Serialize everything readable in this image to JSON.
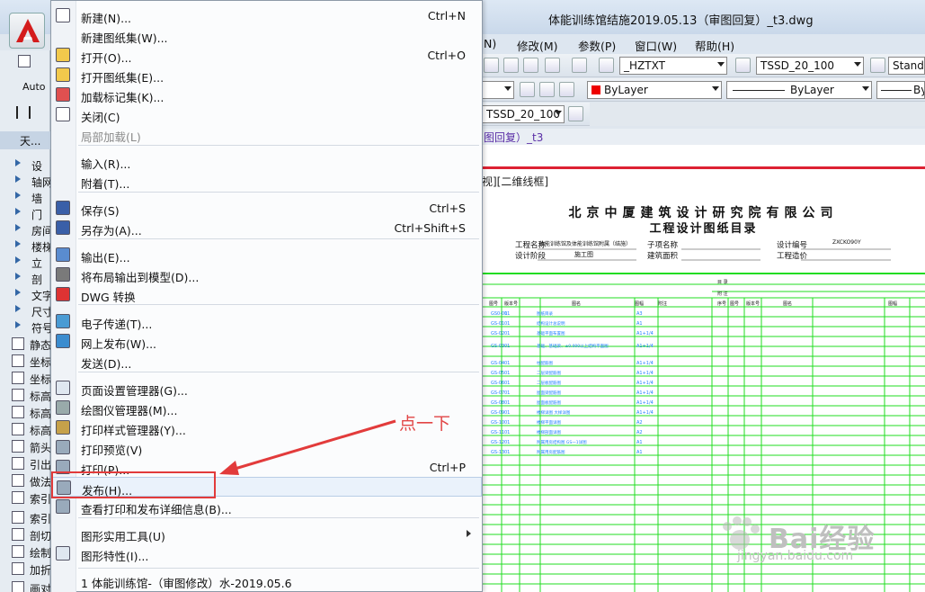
{
  "window": {
    "title": "体能训练馆结施2019.05.13（审图回复）_t3.dwg"
  },
  "menubar": {
    "items": [
      "N)",
      "修改(M)",
      "参数(P)",
      "窗口(W)",
      "帮助(H)"
    ]
  },
  "toolbar1": {
    "textstyle": "_HZTXT",
    "dimstyle": "TSSD_20_100",
    "tablestyle": "Standa"
  },
  "toolbar2": {
    "color": "ByLayer",
    "linetype": "ByLayer",
    "lineweight": "By"
  },
  "toolbar3": {
    "style": "TSSD_20_100"
  },
  "document": {
    "tab_fragment": "图回复）_t3",
    "view_label": "视][二维线框]"
  },
  "drawing": {
    "company": "北京中厦建筑设计研究院有限公司",
    "title": "工程设计图纸目录",
    "h_project": "工程名称",
    "h_project_val": "体能训练馆及体能训练馆附属（结施）",
    "h_subitem": "子项名称",
    "h_design_no": "设计编号",
    "h_design_no_val": "ZXCKO90Y",
    "h_stage": "设计阶段",
    "h_stage_val": "施工图",
    "h_area": "建筑面积",
    "h_cost": "工程造价",
    "col_headers": [
      "图号",
      "版本号",
      "图名",
      "图幅",
      "附注",
      "序号",
      "图号",
      "版本号",
      "图名",
      "图幅"
    ],
    "rows": [
      {
        "no": "GS0-01",
        "ver": "01",
        "name": "图纸目录",
        "size": "A3"
      },
      {
        "no": "GS-01",
        "ver": "01",
        "name": "结构设计总说明",
        "size": "A1"
      },
      {
        "no": "GS-02",
        "ver": "01",
        "name": "基础平面布置图",
        "size": "A1+1/4"
      },
      {
        "no": "GS-03",
        "ver": "01",
        "name": "基础、基础梁、±0.000以上结构平面图",
        "size": "A1+1/4"
      },
      {
        "no": "GS-04",
        "ver": "01",
        "name": "柱配筋图",
        "size": "A1+1/4"
      },
      {
        "no": "GS-05",
        "ver": "01",
        "name": "二层梁配筋图",
        "size": "A1+1/4"
      },
      {
        "no": "GS-06",
        "ver": "01",
        "name": "二层板配筋图",
        "size": "A1+1/4"
      },
      {
        "no": "GS-07",
        "ver": "01",
        "name": "屋面梁配筋图",
        "size": "A1+1/4"
      },
      {
        "no": "GS-08",
        "ver": "01",
        "name": "屋面板配筋图",
        "size": "A1+1/4"
      },
      {
        "no": "GS-09",
        "ver": "01",
        "name": "楼梯详图 大样详图",
        "size": "A1+1/4"
      },
      {
        "no": "GS-10",
        "ver": "01",
        "name": "楼梯平面详图",
        "size": "A2"
      },
      {
        "no": "GS-11",
        "ver": "01",
        "name": "楼梯剖面详图",
        "size": "A2"
      },
      {
        "no": "GS-12",
        "ver": "01",
        "name": "附属用房结构图 GS一1详图",
        "size": "A1"
      },
      {
        "no": "GS-13",
        "ver": "01",
        "name": "附属用房配筋图",
        "size": "A1"
      }
    ]
  },
  "leftpanel": {
    "ribbon1": "Auto",
    "tab": "天...",
    "items": [
      "设",
      "轴网",
      "墙",
      "门",
      "房间",
      "楼梯",
      "立",
      "剖",
      "文字",
      "尺寸",
      "符号"
    ],
    "tools": [
      "静态",
      "坐标",
      "坐标",
      "标高",
      "标高",
      "标高",
      "箭头",
      "引出",
      "做法",
      "索引",
      "索引",
      "剖切",
      "绘制",
      "加折",
      "画对"
    ]
  },
  "menu": {
    "items": [
      {
        "icon": "new-icon",
        "label": "新建(N)...",
        "shortcut": "Ctrl+N"
      },
      {
        "icon": "",
        "label": "新建图纸集(W)...",
        "shortcut": ""
      },
      {
        "icon": "open-icon",
        "label": "打开(O)...",
        "shortcut": "Ctrl+O"
      },
      {
        "icon": "open-sheetset-icon",
        "label": "打开图纸集(E)...",
        "shortcut": ""
      },
      {
        "icon": "markup-icon",
        "label": "加载标记集(K)...",
        "shortcut": ""
      },
      {
        "icon": "close-icon",
        "label": "关闭(C)",
        "shortcut": ""
      },
      {
        "icon": "",
        "label": "局部加载(L)",
        "shortcut": ""
      },
      {
        "icon": "",
        "label": "输入(R)...",
        "shortcut": ""
      },
      {
        "icon": "",
        "label": "附着(T)...",
        "shortcut": ""
      },
      {
        "icon": "save-icon",
        "label": "保存(S)",
        "shortcut": "Ctrl+S"
      },
      {
        "icon": "saveas-icon",
        "label": "另存为(A)...",
        "shortcut": "Ctrl+Shift+S"
      },
      {
        "icon": "export-icon",
        "label": "输出(E)...",
        "shortcut": ""
      },
      {
        "icon": "layout-to-model-icon",
        "label": "将布局输出到模型(D)...",
        "shortcut": ""
      },
      {
        "icon": "dwg-convert-icon",
        "label": "DWG 转换",
        "shortcut": ""
      },
      {
        "icon": "etransmit-icon",
        "label": "电子传递(T)...",
        "shortcut": ""
      },
      {
        "icon": "publish-web-icon",
        "label": "网上发布(W)...",
        "shortcut": ""
      },
      {
        "icon": "",
        "label": "发送(D)...",
        "shortcut": ""
      },
      {
        "icon": "page-setup-icon",
        "label": "页面设置管理器(G)...",
        "shortcut": ""
      },
      {
        "icon": "plotter-icon",
        "label": "绘图仪管理器(M)...",
        "shortcut": ""
      },
      {
        "icon": "plot-style-icon",
        "label": "打印样式管理器(Y)...",
        "shortcut": ""
      },
      {
        "icon": "plot-preview-icon",
        "label": "打印预览(V)",
        "shortcut": ""
      },
      {
        "icon": "plot-icon",
        "label": "打印(P)...",
        "shortcut": "Ctrl+P"
      },
      {
        "icon": "publish-icon",
        "label": "发布(H)...",
        "shortcut": ""
      },
      {
        "icon": "plot-details-icon",
        "label": "查看打印和发布详细信息(B)...",
        "shortcut": ""
      },
      {
        "icon": "",
        "label": "图形实用工具(U)",
        "shortcut": ""
      },
      {
        "icon": "drawing-props-icon",
        "label": "图形特性(I)...",
        "shortcut": ""
      }
    ],
    "recent": "1 体能训练馆-（审图修改）水-2019.05.6"
  },
  "annotation": {
    "text": "点一下"
  },
  "watermark": {
    "brand": "Bai",
    "brand2": "经验",
    "url": "jingyan.baidu.com"
  }
}
